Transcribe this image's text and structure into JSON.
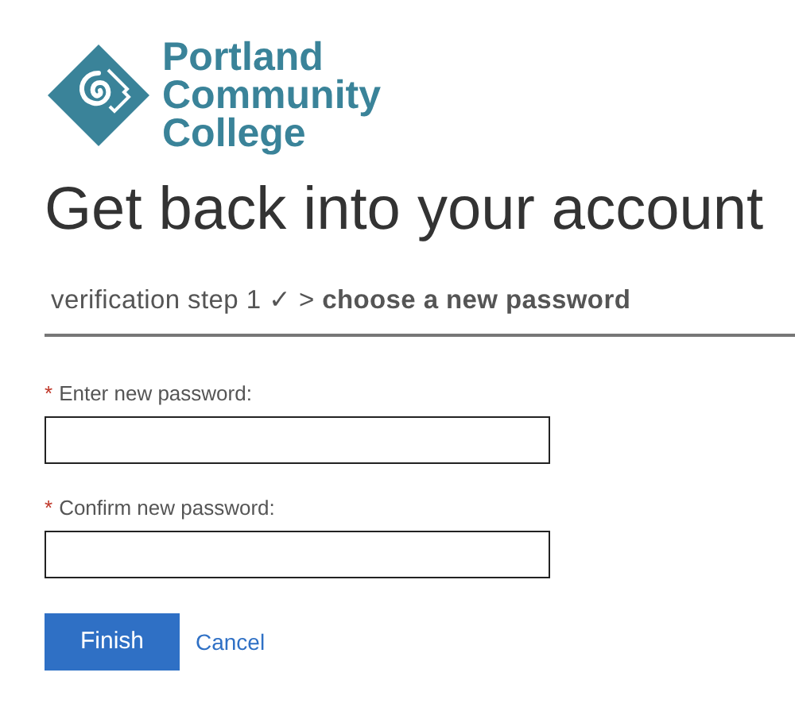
{
  "logo": {
    "lines": [
      "Portland",
      "Community",
      "College"
    ]
  },
  "title": "Get back into your account",
  "breadcrumb": "verification step 1 ✓ > **choose a new password**",
  "fields": [
    {
      "required_mark": "*",
      "label": "Enter new password:"
    },
    {
      "required_mark": "*",
      "label": "Confirm new password:"
    }
  ],
  "buttons": [
    {
      "kind": "primary",
      "label": "Finish"
    },
    {
      "kind": "link",
      "label": "Cancel"
    }
  ]
}
